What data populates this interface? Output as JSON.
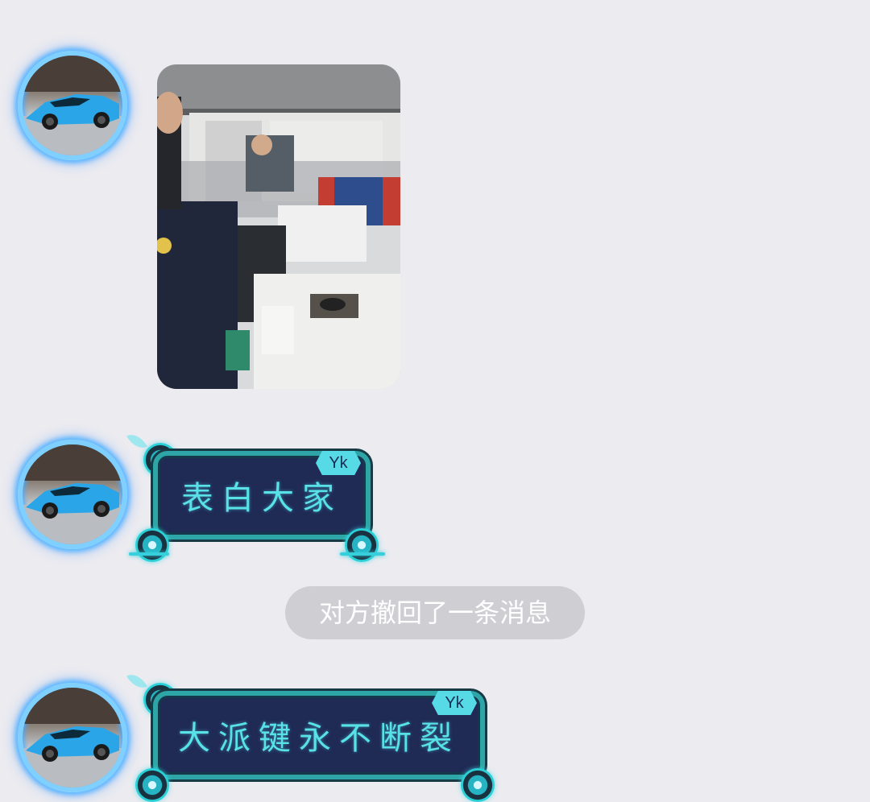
{
  "messages": [
    {
      "kind": "image",
      "sender_avatar": "blue-sports-car-avatar",
      "image_content": "office-photo"
    },
    {
      "kind": "text",
      "sender_avatar": "blue-sports-car-avatar",
      "text": "表白大家",
      "badge": "Yk"
    },
    {
      "kind": "system",
      "text": "对方撤回了一条消息"
    },
    {
      "kind": "text",
      "sender_avatar": "blue-sports-car-avatar",
      "text": "大派键永不断裂",
      "badge": "Yk"
    }
  ],
  "colors": {
    "background": "#ebebf0",
    "bubble_fill": "#1f2a55",
    "bubble_border": "#2ea6a8",
    "bubble_text": "#58e2e8",
    "badge": "#56dbe6",
    "notice_bg": "#cfcfd3",
    "avatar_glow": "#5ab8ff"
  }
}
